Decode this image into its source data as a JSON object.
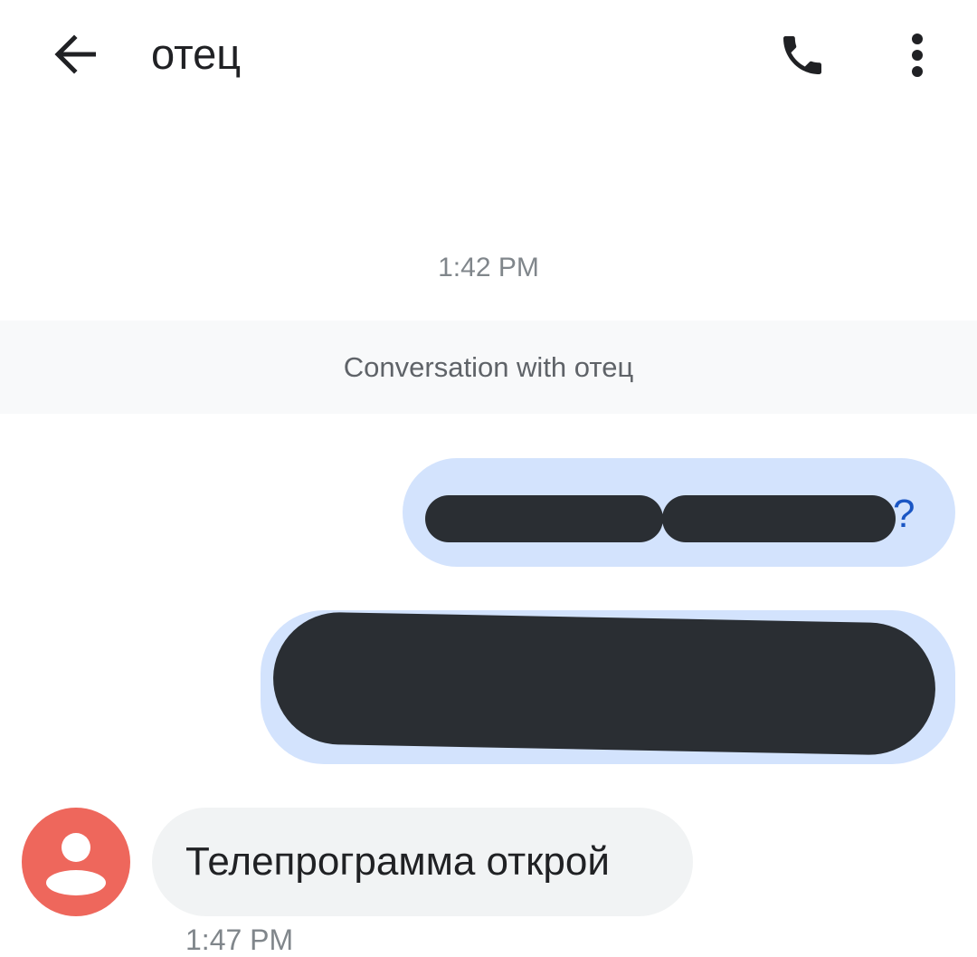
{
  "appbar": {
    "title": "отец",
    "back_icon": "arrow-back-icon",
    "call_icon": "phone-icon",
    "more_icon": "more-vert-icon"
  },
  "conversation": {
    "timestamp_top": "1:42 PM",
    "banner_text": "Conversation with отец",
    "outgoing": [
      {
        "visible_text": "?",
        "redacted": true
      },
      {
        "visible_text": "",
        "redacted": true
      }
    ],
    "incoming": {
      "text": "Телепрограмма открой",
      "timestamp": "1:47 PM",
      "avatar_icon": "person-icon"
    }
  },
  "colors": {
    "outgoing_bubble": "#d3e3fd",
    "incoming_bubble": "#f1f3f4",
    "avatar": "#ee675c",
    "redaction": "#2a2e33",
    "banner_bg": "#f8f9fa",
    "link_blue": "#1a56c4"
  }
}
